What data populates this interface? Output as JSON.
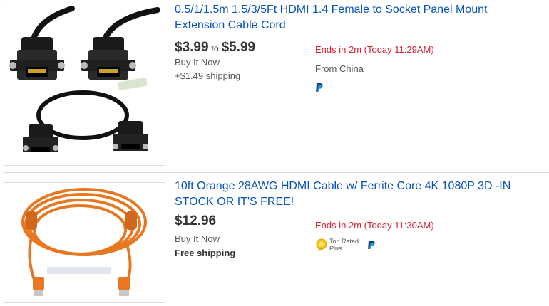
{
  "listings": [
    {
      "title": "0.5/1/1.5m 1.5/3/5Ft HDMI 1.4 Female to Socket Panel Mount Extension Cable Cord",
      "price_low": "$3.99",
      "price_to": "to",
      "price_high": "$5.99",
      "format": "Buy It Now",
      "shipping": "+$1.49 shipping",
      "ends": "Ends in 2m (Today 11:29AM)",
      "origin": "From China",
      "payment_icon": "paypal-icon",
      "image_description": "black HDMI female panel mount extension cable"
    },
    {
      "title": "10ft Orange 28AWG HDMI Cable w/ Ferrite Core 4K 1080P 3D -IN STOCK OR IT'S FREE!",
      "price": "$12.96",
      "format": "Buy It Now",
      "shipping": "Free shipping",
      "ends": "Ends in 2m (Today 11:30AM)",
      "badge": "Top Rated Plus",
      "badge_icon": "top-rated-seal-icon",
      "payment_icon": "paypal-icon",
      "image_description": "coiled orange HDMI cable with ferrite cores"
    }
  ],
  "colors": {
    "title_link": "#0654ba",
    "ends_red": "#dd1e31",
    "paypal_dark": "#253b80",
    "paypal_light": "#179bd7",
    "orange_cable": "#e87722"
  }
}
